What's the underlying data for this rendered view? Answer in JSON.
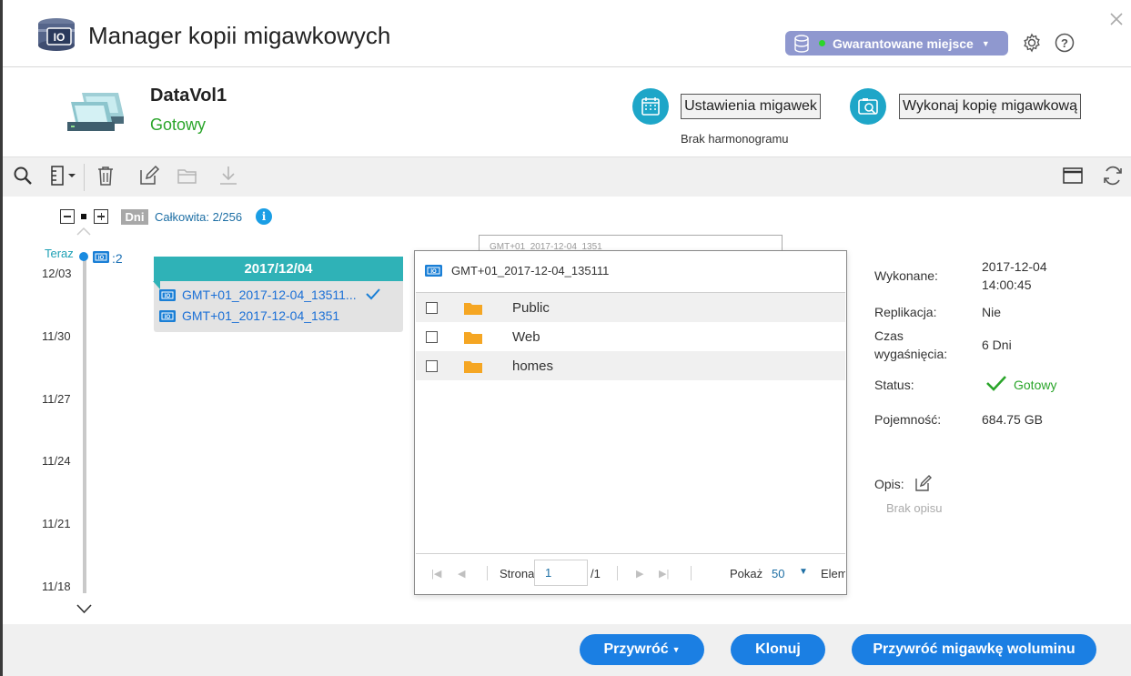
{
  "app": {
    "title": "Manager kopii migawkowych",
    "space_label": "Gwarantowane miejsce",
    "accent": "#1ea6c8"
  },
  "volume": {
    "name": "DataVol1",
    "status": "Gotowy",
    "schedule_button": "Ustawienia migawek",
    "snapshot_button": "Wykonaj kopię migawkową",
    "schedule_status": "Brak harmonogramu"
  },
  "timeline": {
    "unit": "Dni",
    "total": "Całkowita: 2/256",
    "now_label": "Teraz",
    "now_count": ":2",
    "dates": [
      "12/03",
      "11/30",
      "11/27",
      "11/24",
      "11/21",
      "11/18"
    ]
  },
  "day_card": {
    "date": "2017/12/04",
    "snapshots": [
      "GMT+01_2017-12-04_13511...",
      "GMT+01_2017-12-04_1351"
    ]
  },
  "ghost_label": "GMT+01_2017-12-04_1351",
  "browser": {
    "title": "GMT+01_2017-12-04_135111",
    "folders": [
      "Public",
      "Web",
      "homes"
    ],
    "pager": {
      "page_label": "Strona",
      "page": "1",
      "total": "/1",
      "show_label": "Pokaż",
      "per_page": "50",
      "items_label": "Elem"
    }
  },
  "properties": {
    "created_label": "Wykonane:",
    "created_date": "2017-12-04",
    "created_time": "14:00:45",
    "replication_label": "Replikacja:",
    "replication_value": "Nie",
    "expire_label_1": "Czas",
    "expire_label_2": "wygaśnięcia:",
    "expire_value": "6 Dni",
    "status_label": "Status:",
    "status_value": "Gotowy",
    "capacity_label": "Pojemność:",
    "capacity_value": "684.75 GB",
    "desc_label": "Opis:",
    "desc_value": "Brak opisu"
  },
  "footer": {
    "restore": "Przywróć",
    "clone": "Klonuj",
    "revert": "Przywróć migawkę woluminu"
  }
}
